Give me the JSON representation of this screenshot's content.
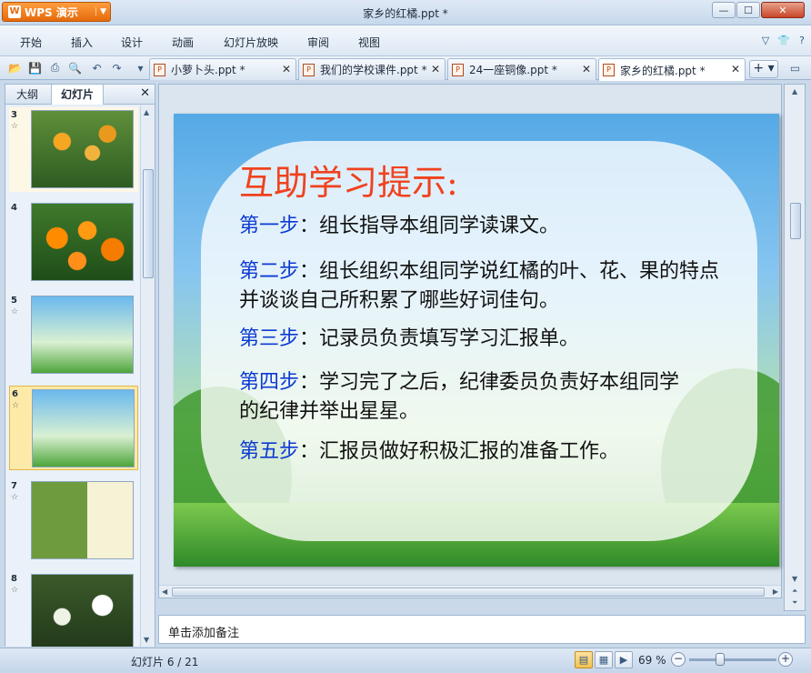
{
  "app": {
    "name": "WPS 演示",
    "logo_letter": "W",
    "window_title": "家乡的红橘.ppt *"
  },
  "menu": [
    "开始",
    "插入",
    "设计",
    "动画",
    "幻灯片放映",
    "审阅",
    "视图"
  ],
  "doc_tabs": [
    {
      "label": "小萝卜头.ppt *",
      "active": false
    },
    {
      "label": "我们的学校课件.ppt *",
      "active": false
    },
    {
      "label": "24一座铜像.ppt *",
      "active": false
    },
    {
      "label": "家乡的红橘.ppt *",
      "active": true
    }
  ],
  "left_panel": {
    "tabs": [
      {
        "label": "大纲"
      },
      {
        "label": "幻灯片"
      }
    ],
    "active_tab": "幻灯片",
    "thumbnails": [
      {
        "number": "3",
        "content": "orange-tree-photo"
      },
      {
        "number": "4",
        "content": "oranges-photo"
      },
      {
        "number": "5",
        "content": "text-slide"
      },
      {
        "number": "6",
        "content": "text-slide",
        "selected": true
      },
      {
        "number": "7",
        "content": "leaves-text-slide"
      },
      {
        "number": "8",
        "content": "flowers-photo"
      }
    ]
  },
  "slide": {
    "title": "互助学习提示:",
    "steps": [
      {
        "label": "第一步",
        "text": "：组长指导本组同学读课文。"
      },
      {
        "label": "第二步",
        "text": "：组长组织本组同学说红橘的叶、花、果的特点并谈谈自己所积累了哪些好词佳句。"
      },
      {
        "label": "第三步",
        "text": "：记录员负责填写学习汇报单。"
      },
      {
        "label": "第四步",
        "text": "：学习完了之后，纪律委员负责好本组同学的纪律并举出星星。"
      },
      {
        "label": "第五步",
        "text": "：汇报员做好积极汇报的准备工作。"
      }
    ],
    "colors": {
      "title": "#f0421e",
      "step_label": "#0c3ad2",
      "body": "#111111"
    }
  },
  "notes": {
    "placeholder": "单击添加备注"
  },
  "status": {
    "slide_counter": "幻灯片 6 / 21",
    "zoom": "69 %",
    "zoom_level": 0.35
  },
  "icons": [
    "open-icon",
    "save-icon",
    "print-icon",
    "print-preview-icon",
    "undo-icon",
    "redo-icon",
    "customize-icon",
    "skin-icon",
    "help-icon"
  ]
}
